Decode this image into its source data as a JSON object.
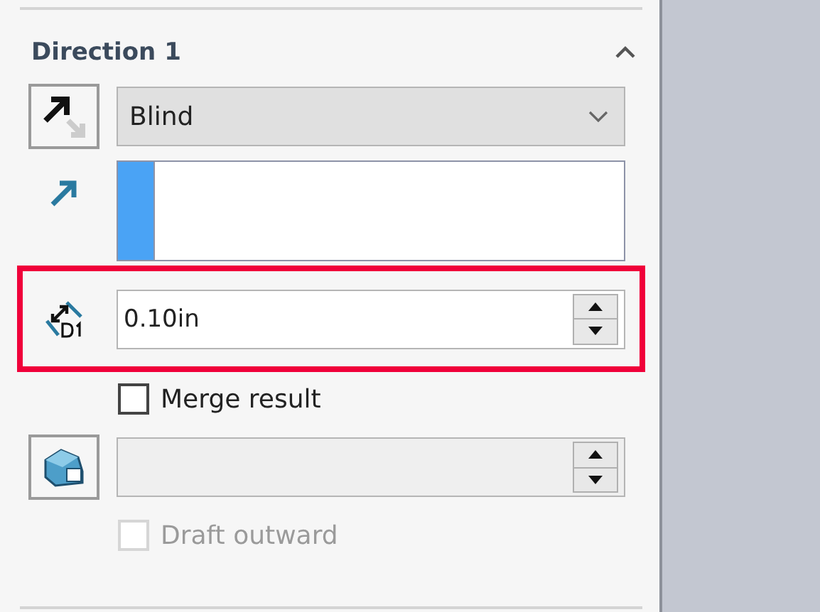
{
  "section": {
    "title": "Direction 1",
    "expanded": true
  },
  "end_condition": {
    "value": "Blind"
  },
  "selection": {
    "selected": true
  },
  "depth": {
    "value": "0.10in",
    "highlighted": true
  },
  "merge_result": {
    "label": "Merge result",
    "checked": false,
    "disabled": false
  },
  "draft": {
    "disabled": true
  },
  "draft_outward": {
    "label": "Draft outward",
    "checked": false,
    "disabled": true
  }
}
